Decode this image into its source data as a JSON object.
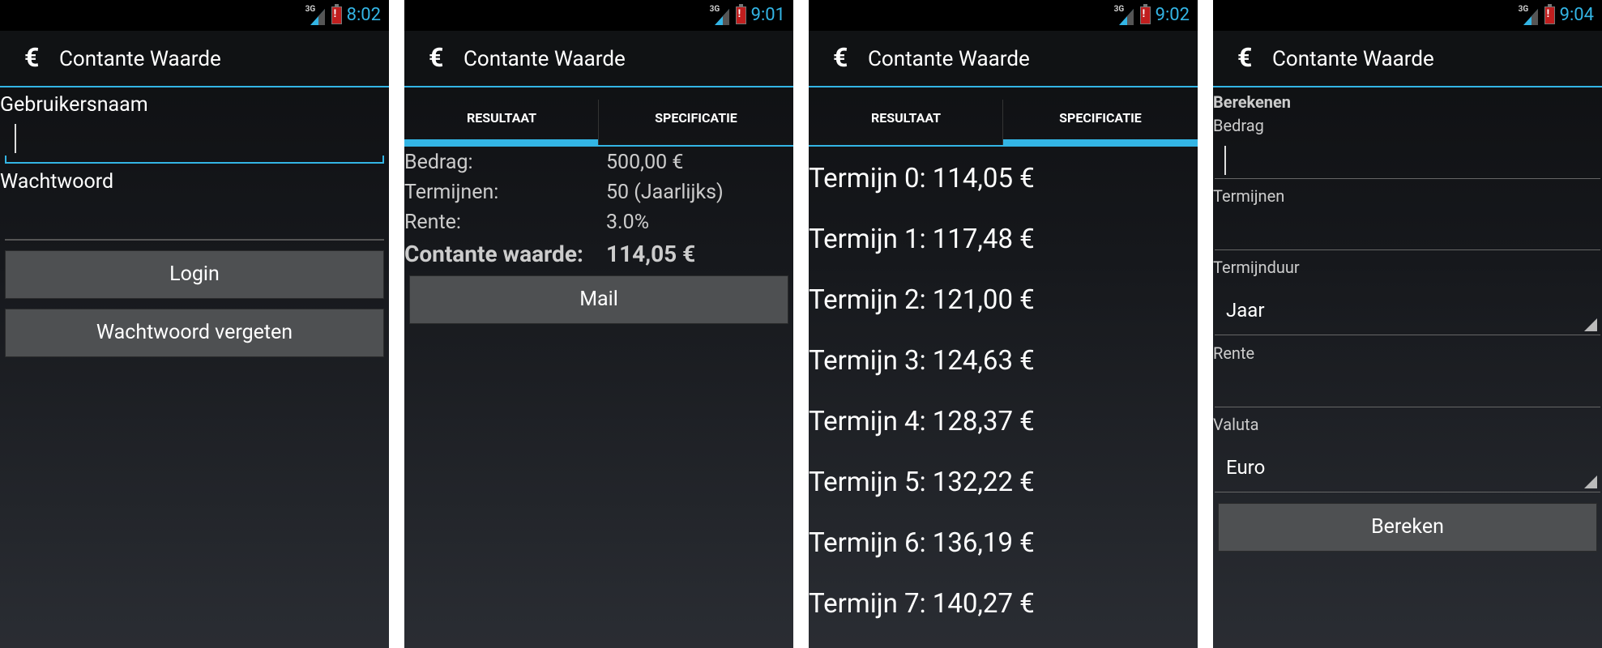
{
  "app": {
    "title": "Contante Waarde",
    "logo": "€"
  },
  "screens": {
    "login": {
      "time": "8:02",
      "username_label": "Gebruikersnaam",
      "username_value": "",
      "password_label": "Wachtwoord",
      "password_value": "",
      "login_button": "Login",
      "forgot_button": "Wachtwoord vergeten"
    },
    "result": {
      "time": "9:01",
      "tabs": [
        "RESULTAAT",
        "SPECIFICATIE"
      ],
      "rows": [
        {
          "label": "Bedrag:",
          "value": "500,00 €"
        },
        {
          "label": "Termijnen:",
          "value": "50 (Jaarlijks)"
        },
        {
          "label": "Rente:",
          "value": "3.0%"
        },
        {
          "label": "Contante waarde:",
          "value": "114,05 €"
        }
      ],
      "mail_button": "Mail"
    },
    "specification": {
      "time": "9:02",
      "tabs": [
        "RESULTAAT",
        "SPECIFICATIE"
      ],
      "terms": [
        "Termijn 0: 114,05 €",
        "Termijn 1: 117,48 €",
        "Termijn 2: 121,00 €",
        "Termijn 3: 124,63 €",
        "Termijn 4: 128,37 €",
        "Termijn 5: 132,22 €",
        "Termijn 6: 136,19 €",
        "Termijn 7: 140,27 €"
      ]
    },
    "calculate": {
      "time": "9:04",
      "section_title": "Berekenen",
      "amount_label": "Bedrag",
      "amount_value": "",
      "terms_label": "Termijnen",
      "terms_value": "",
      "duration_label": "Termijnduur",
      "duration_value": "Jaar",
      "rate_label": "Rente",
      "rate_value": "",
      "currency_label": "Valuta",
      "currency_value": "Euro",
      "calculate_button": "Bereken"
    }
  },
  "status": {
    "network": "3G",
    "battery": "!"
  },
  "colors": {
    "accent": "#33b5e5",
    "button": "#4e5052",
    "background": "#0d0e10"
  },
  "icons": [
    "signal-icon",
    "battery-alert-icon",
    "euro-logo-icon",
    "spinner-arrow-icon"
  ]
}
